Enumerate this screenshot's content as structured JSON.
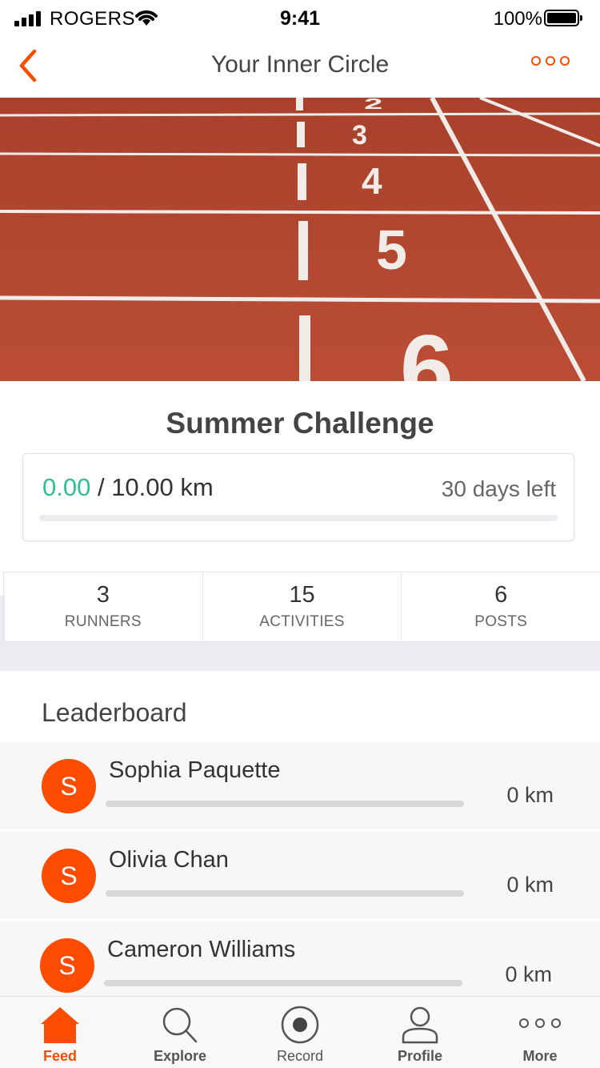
{
  "status_bar": {
    "carrier": "ROGERS",
    "time": "9:41",
    "battery": "100%"
  },
  "nav": {
    "title": "Your Inner Circle",
    "back_icon": "chevron-left-icon",
    "more_icon": "more-dots-icon"
  },
  "hero": {
    "lane_numbers": [
      "2",
      "3",
      "4",
      "5",
      "6"
    ]
  },
  "challenge": {
    "title": "Summer Challenge",
    "current": "0.00",
    "separator": " / ",
    "goal": "10.00 km",
    "days_left": "30 days left",
    "progress_fraction": 0
  },
  "stats": [
    {
      "value": "3",
      "label": "RUNNERS"
    },
    {
      "value": "15",
      "label": "ACTIVITIES"
    },
    {
      "value": "6",
      "label": "POSTS"
    }
  ],
  "leaderboard": {
    "title": "Leaderboard",
    "entries": [
      {
        "initial": "S",
        "name": "Sophia Paquette",
        "distance": "0 km",
        "progress_fraction": 0
      },
      {
        "initial": "S",
        "name": "Olivia Chan",
        "distance": "0 km",
        "progress_fraction": 0
      },
      {
        "initial": "S",
        "name": "Cameron Williams",
        "distance": "0 km",
        "progress_fraction": 0
      }
    ]
  },
  "tabs": [
    {
      "label": "Feed",
      "icon": "home-icon",
      "active": true
    },
    {
      "label": "Explore",
      "icon": "search-icon",
      "active": false
    },
    {
      "label": "Record",
      "icon": "record-icon",
      "active": false
    },
    {
      "label": "Profile",
      "icon": "profile-icon",
      "active": false
    },
    {
      "label": "More",
      "icon": "more-dots-icon",
      "active": false
    }
  ],
  "colors": {
    "accent": "#fc4c02",
    "progress": "#2fc094",
    "track": "#b44a33"
  }
}
